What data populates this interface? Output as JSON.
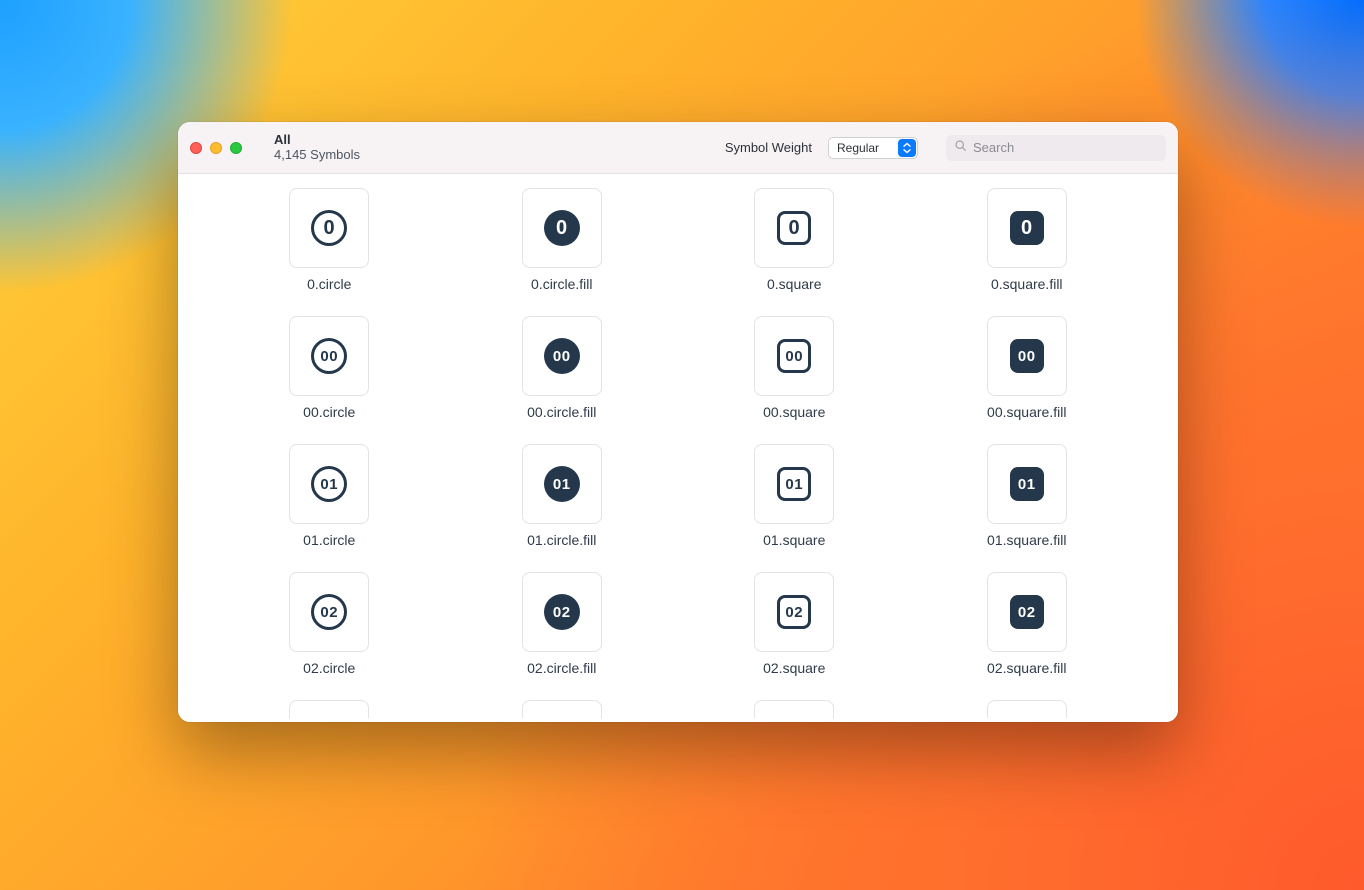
{
  "title": "All",
  "subtitle": "4,145 Symbols",
  "weight_label": "Symbol Weight",
  "weight_value": "Regular",
  "search_placeholder": "Search",
  "symbol_color": "#24374b",
  "symbols": [
    {
      "name": "0.circle",
      "shape": "circle",
      "fill": false,
      "text": "0"
    },
    {
      "name": "0.circle.fill",
      "shape": "circle",
      "fill": true,
      "text": "0"
    },
    {
      "name": "0.square",
      "shape": "square",
      "fill": false,
      "text": "0"
    },
    {
      "name": "0.square.fill",
      "shape": "square",
      "fill": true,
      "text": "0"
    },
    {
      "name": "00.circle",
      "shape": "circle",
      "fill": false,
      "text": "00"
    },
    {
      "name": "00.circle.fill",
      "shape": "circle",
      "fill": true,
      "text": "00"
    },
    {
      "name": "00.square",
      "shape": "square",
      "fill": false,
      "text": "00"
    },
    {
      "name": "00.square.fill",
      "shape": "square",
      "fill": true,
      "text": "00"
    },
    {
      "name": "01.circle",
      "shape": "circle",
      "fill": false,
      "text": "01"
    },
    {
      "name": "01.circle.fill",
      "shape": "circle",
      "fill": true,
      "text": "01"
    },
    {
      "name": "01.square",
      "shape": "square",
      "fill": false,
      "text": "01"
    },
    {
      "name": "01.square.fill",
      "shape": "square",
      "fill": true,
      "text": "01"
    },
    {
      "name": "02.circle",
      "shape": "circle",
      "fill": false,
      "text": "02"
    },
    {
      "name": "02.circle.fill",
      "shape": "circle",
      "fill": true,
      "text": "02"
    },
    {
      "name": "02.square",
      "shape": "square",
      "fill": false,
      "text": "02"
    },
    {
      "name": "02.square.fill",
      "shape": "square",
      "fill": true,
      "text": "02"
    }
  ]
}
